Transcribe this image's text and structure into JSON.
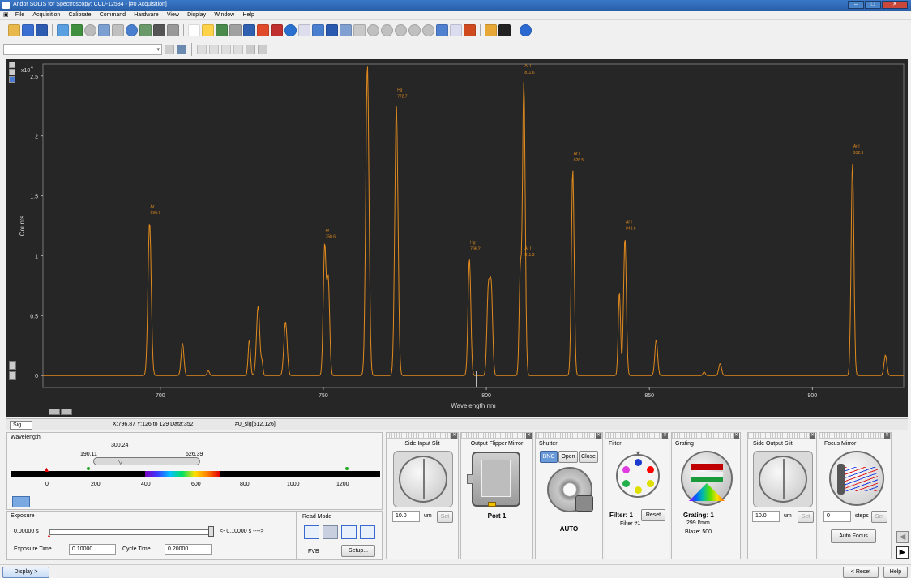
{
  "window": {
    "title": "Andor SOLIS for Spectroscopy: CCD-12584 - [#0  Acquisition]"
  },
  "menu": [
    "File",
    "Acquisition",
    "Calibrate",
    "Command",
    "Hardware",
    "View",
    "Display",
    "Window",
    "Help"
  ],
  "plot": {
    "exponent_label": "x10",
    "exponent_power": "4",
    "background": "#262626",
    "trace_color": "#e08a1e",
    "status": {
      "tab": "Sig",
      "coords": "X:796.87  Y:126 to 129 Data:352",
      "signal": "#0_sig[512,126]"
    }
  },
  "chart_data": {
    "type": "line",
    "xlabel": "Wavelength nm",
    "ylabel": "Counts",
    "xlim": [
      664,
      928
    ],
    "ylim": [
      -0.1,
      2.6
    ],
    "ylim_note": "units of 10^4 counts",
    "x_ticks": [
      700,
      750,
      800,
      850,
      900
    ],
    "y_ticks": [
      0,
      0.5,
      1,
      1.5,
      2,
      2.5
    ],
    "y_tick_labels": [
      "0",
      "0.5",
      "1",
      "1.5",
      "2",
      "2.5"
    ],
    "peaks": [
      {
        "x": 696.7,
        "y": 1.28,
        "w": 0.7
      },
      {
        "x": 706.8,
        "y": 0.27,
        "w": 0.6
      },
      {
        "x": 714.7,
        "y": 0.04,
        "w": 0.5
      },
      {
        "x": 727.3,
        "y": 0.3,
        "w": 0.5
      },
      {
        "x": 730.0,
        "y": 0.58,
        "w": 0.7
      },
      {
        "x": 731.2,
        "y": 0.1,
        "w": 0.4
      },
      {
        "x": 738.4,
        "y": 0.45,
        "w": 0.7
      },
      {
        "x": 750.4,
        "y": 1.08,
        "w": 0.6
      },
      {
        "x": 751.5,
        "y": 0.8,
        "w": 0.6
      },
      {
        "x": 763.5,
        "y": 2.6,
        "w": 0.7
      },
      {
        "x": 772.4,
        "y": 2.25,
        "w": 0.7
      },
      {
        "x": 794.8,
        "y": 0.98,
        "w": 0.6
      },
      {
        "x": 800.6,
        "y": 0.7,
        "w": 0.6
      },
      {
        "x": 801.5,
        "y": 0.72,
        "w": 0.6
      },
      {
        "x": 810.4,
        "y": 0.85,
        "w": 0.5
      },
      {
        "x": 811.5,
        "y": 2.45,
        "w": 0.6
      },
      {
        "x": 826.5,
        "y": 1.72,
        "w": 0.6
      },
      {
        "x": 840.8,
        "y": 0.7,
        "w": 0.5
      },
      {
        "x": 842.5,
        "y": 1.15,
        "w": 0.6
      },
      {
        "x": 852.1,
        "y": 0.3,
        "w": 0.6
      },
      {
        "x": 866.8,
        "y": 0.03,
        "w": 0.5
      },
      {
        "x": 871.7,
        "y": 0.1,
        "w": 0.6
      },
      {
        "x": 912.3,
        "y": 1.78,
        "w": 0.6
      },
      {
        "x": 922.4,
        "y": 0.17,
        "w": 0.6
      }
    ],
    "baseline": 0.0,
    "annotations": [
      {
        "x": 696.7,
        "y": 1.28,
        "line1": "Ar I",
        "line2": "696.7"
      },
      {
        "x": 750.4,
        "y": 1.08,
        "line1": "Ar I",
        "line2": "750.6"
      },
      {
        "x": 772.4,
        "y": 2.25,
        "line1": "Hg I",
        "line2": "772.7"
      },
      {
        "x": 794.8,
        "y": 0.98,
        "line1": "Hg I",
        "line2": "796.2"
      },
      {
        "x": 811.5,
        "y": 2.45,
        "line1": "Ar I",
        "line2": "811.6"
      },
      {
        "x": 811.5,
        "y": 0.93,
        "line1": "Ar I",
        "line2": "811.3"
      },
      {
        "x": 826.5,
        "y": 1.72,
        "line1": "Ar I",
        "line2": "826.5"
      },
      {
        "x": 842.5,
        "y": 1.15,
        "line1": "Ar I",
        "line2": "842.6"
      },
      {
        "x": 912.3,
        "y": 1.78,
        "line1": "Ar I",
        "line2": "912.3"
      }
    ],
    "cursor_x": 796.87
  },
  "wavelength": {
    "title": "Wavelength",
    "min_label": "190.11",
    "center_label": "300.24",
    "max_label": "626.39",
    "ticks": [
      "0",
      "200",
      "400",
      "600",
      "800",
      "1000",
      "1200"
    ]
  },
  "exposure": {
    "title": "Exposure",
    "min": "0.00000 s",
    "max": "<- 0.10000 s ---->",
    "exposure_time_label": "Exposure Time",
    "exposure_time": "0.10000",
    "cycle_time_label": "Cycle Time",
    "cycle_time": "0.20000"
  },
  "read_mode": {
    "title": "Read Mode",
    "mode": "FVB",
    "setup": "Setup..."
  },
  "side_input_slit": {
    "title": "Side Input Slit",
    "value": "10.0",
    "unit": "um",
    "set": "Set"
  },
  "output_flipper": {
    "title": "Output Flipper Mirror",
    "port": "Port 1"
  },
  "shutter": {
    "title": "Shutter",
    "bnc": "BNC",
    "open": "Open",
    "close": "Close",
    "mode": "AUTO"
  },
  "filter": {
    "title": "Filter",
    "current": "Filter: 1",
    "reset": "Reset",
    "name": "Filter #1"
  },
  "grating": {
    "title": "Grating",
    "current": "Grating: 1",
    "lines": "299 l/mm",
    "blaze": "Blaze: 500"
  },
  "side_output_slit": {
    "title": "Side Output Slit",
    "value": "10.0",
    "unit": "um",
    "set": "Set"
  },
  "focus_mirror": {
    "title": "Focus Mirror",
    "value": "0",
    "unit": "steps",
    "set": "Set",
    "auto": "Auto Focus"
  },
  "statusbar": {
    "display": "Display >",
    "reset": "< Reset",
    "help": "Help"
  }
}
